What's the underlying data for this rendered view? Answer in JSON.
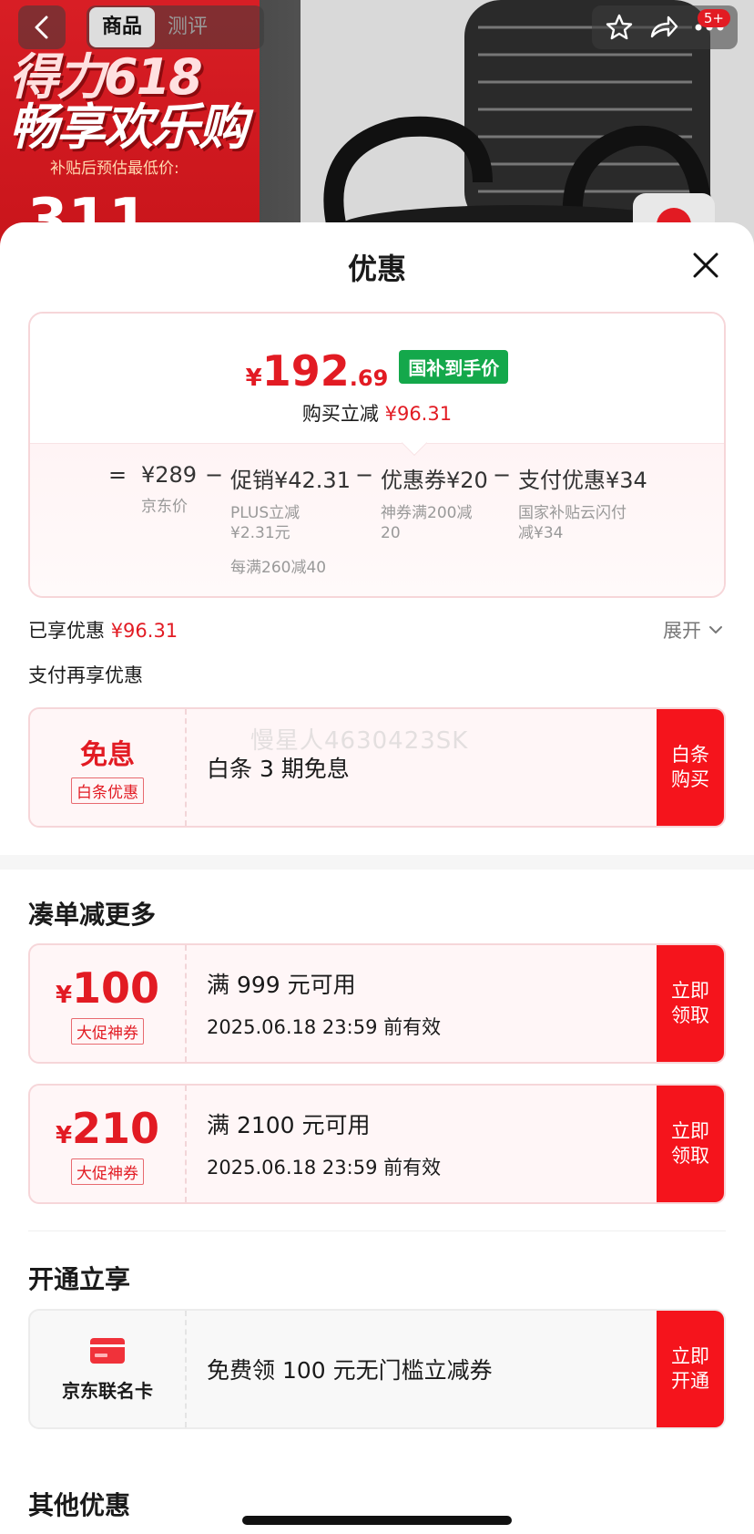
{
  "header": {
    "tabs": [
      {
        "label": "商品",
        "active": true
      },
      {
        "label": "测评",
        "active": false
      }
    ],
    "cart_badge": "5+",
    "promo_banner": {
      "line1": "得力618",
      "line2": "畅享欢乐购",
      "subtitle": "补贴后预估最低价:",
      "price_partial": "311"
    }
  },
  "sheet": {
    "title": "优惠",
    "summary": {
      "currency": "¥",
      "price_int": "192",
      "price_dec": ".69",
      "tag": "国补到手价",
      "save_label": "购买立减",
      "save_amount": "¥96.31",
      "formula": {
        "equals": "=",
        "minus": "−",
        "items": [
          {
            "main": "¥289",
            "sub": [
              "京东价"
            ]
          },
          {
            "main": "促销¥42.31",
            "sub": [
              "PLUS立减",
              "¥2.31元"
            ],
            "extra": "每满260减40"
          },
          {
            "main": "优惠券¥20",
            "sub": [
              "神券满200减",
              "20"
            ]
          },
          {
            "main": "支付优惠¥34",
            "sub": [
              "国家补贴云闪付",
              "减¥34"
            ]
          }
        ]
      }
    },
    "enjoyed_label": "已享优惠",
    "enjoyed_amount": "¥96.31",
    "expand_label": "展开",
    "pay_more_label": "支付再享优惠",
    "watermark": "慢星人4630423SK",
    "baitiao": {
      "title": "免息",
      "tag": "白条优惠",
      "desc": "白条 3 期免息",
      "button": [
        "白条",
        "购买"
      ]
    },
    "bundle_section_title": "凑单减更多",
    "coupons": [
      {
        "currency": "¥",
        "amount": "100",
        "tag": "大促神券",
        "condition": "满 999 元可用",
        "expiry": "2025.06.18 23:59 前有效",
        "button": [
          "立即",
          "领取"
        ]
      },
      {
        "currency": "¥",
        "amount": "210",
        "tag": "大促神券",
        "condition": "满 2100 元可用",
        "expiry": "2025.06.18 23:59 前有效",
        "button": [
          "立即",
          "领取"
        ]
      }
    ],
    "open_section_title": "开通立享",
    "card_offer": {
      "name": "京东联名卡",
      "desc": "免费领 100 元无门槛立减券",
      "button": [
        "立即",
        "开通"
      ]
    },
    "other_section_title": "其他优惠"
  },
  "colors": {
    "accent_red": "#e21b23",
    "button_red": "#f5141c",
    "tag_green": "#14a84b"
  },
  "icons": [
    "back-arrow-icon",
    "star-icon",
    "share-icon",
    "more-icon",
    "close-icon",
    "chevron-down-icon",
    "credit-card-icon"
  ]
}
